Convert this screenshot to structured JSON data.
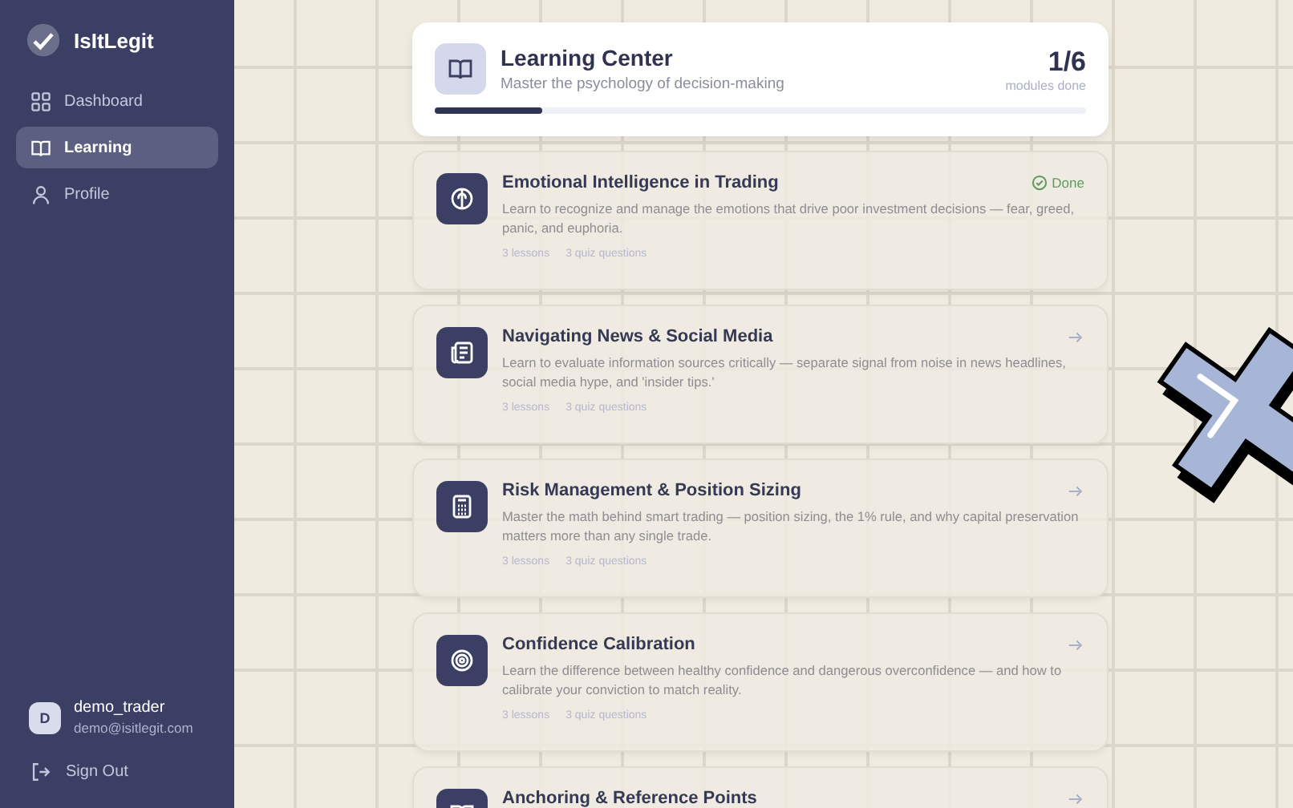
{
  "sidebar": {
    "brand": "IsItLegit",
    "items": [
      {
        "label": "Dashboard",
        "selected": false
      },
      {
        "label": "Learning",
        "selected": true
      },
      {
        "label": "Profile",
        "selected": false
      }
    ],
    "user": {
      "initial": "D",
      "name": "demo_trader",
      "email": "demo@isitlegit.com"
    },
    "sign_out": "Sign Out"
  },
  "header": {
    "title": "Learning Center",
    "subtitle": "Master the psychology of decision-making",
    "count": "1/6",
    "count_label": "modules done",
    "level": 0.166
  },
  "modules": [
    {
      "title": "Emotional Intelligence in Trading",
      "description": "Learn to recognize and manage the emotions that drive poor investment decisions — fear, greed, panic, and euphoria.",
      "completed": true,
      "status": "Done",
      "lessons": "3 lessons",
      "quiz": "3 quiz questions"
    },
    {
      "title": "Navigating News & Social Media",
      "description": "Learn to evaluate information sources critically — separate signal from noise in news headlines, social media hype, and 'insider tips.'",
      "completed": false,
      "lessons": "3 lessons",
      "quiz": "3 quiz questions"
    },
    {
      "title": "Risk Management & Position Sizing",
      "description": "Master the math behind smart trading — position sizing, the 1% rule, and why capital preservation matters more than any single trade.",
      "completed": false,
      "lessons": "3 lessons",
      "quiz": "3 quiz questions"
    },
    {
      "title": "Confidence Calibration",
      "description": "Learn the difference between healthy confidence and dangerous overconfidence — and how to calibrate your conviction to match reality.",
      "completed": false,
      "lessons": "3 lessons",
      "quiz": "3 quiz questions"
    },
    {
      "title": "Anchoring & Reference Points",
      "completed": false
    }
  ]
}
